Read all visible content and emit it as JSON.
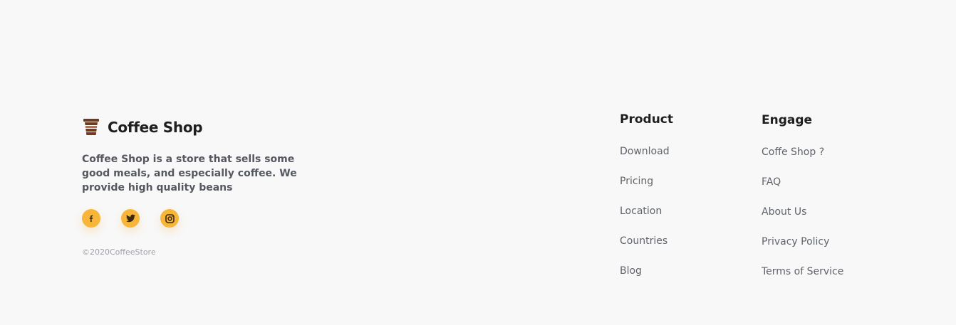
{
  "brand": {
    "name": "Coffee Shop",
    "logo_icon": "coffee-cup-icon",
    "description": "Coffee Shop is a store that sells some good meals, and especially coffee. We provide high quality beans",
    "copyright": "©2020CoffeeStore"
  },
  "socials": [
    {
      "icon": "facebook-icon",
      "glyph": "f"
    },
    {
      "icon": "twitter-icon"
    },
    {
      "icon": "instagram-icon"
    }
  ],
  "columns": {
    "product": {
      "title": "Product",
      "links": [
        "Download",
        "Pricing",
        "Location",
        "Countries",
        "Blog"
      ]
    },
    "engage": {
      "title": "Engage",
      "links": [
        "Coffe Shop ?",
        "FAQ",
        "About Us",
        "Privacy Policy",
        "Terms of Service"
      ]
    }
  },
  "colors": {
    "background": "#f8f8f8",
    "accent": "#f7b53a",
    "logo_brown": "#6b3b24",
    "heading": "#1f1f1f",
    "link": "#60646b"
  }
}
